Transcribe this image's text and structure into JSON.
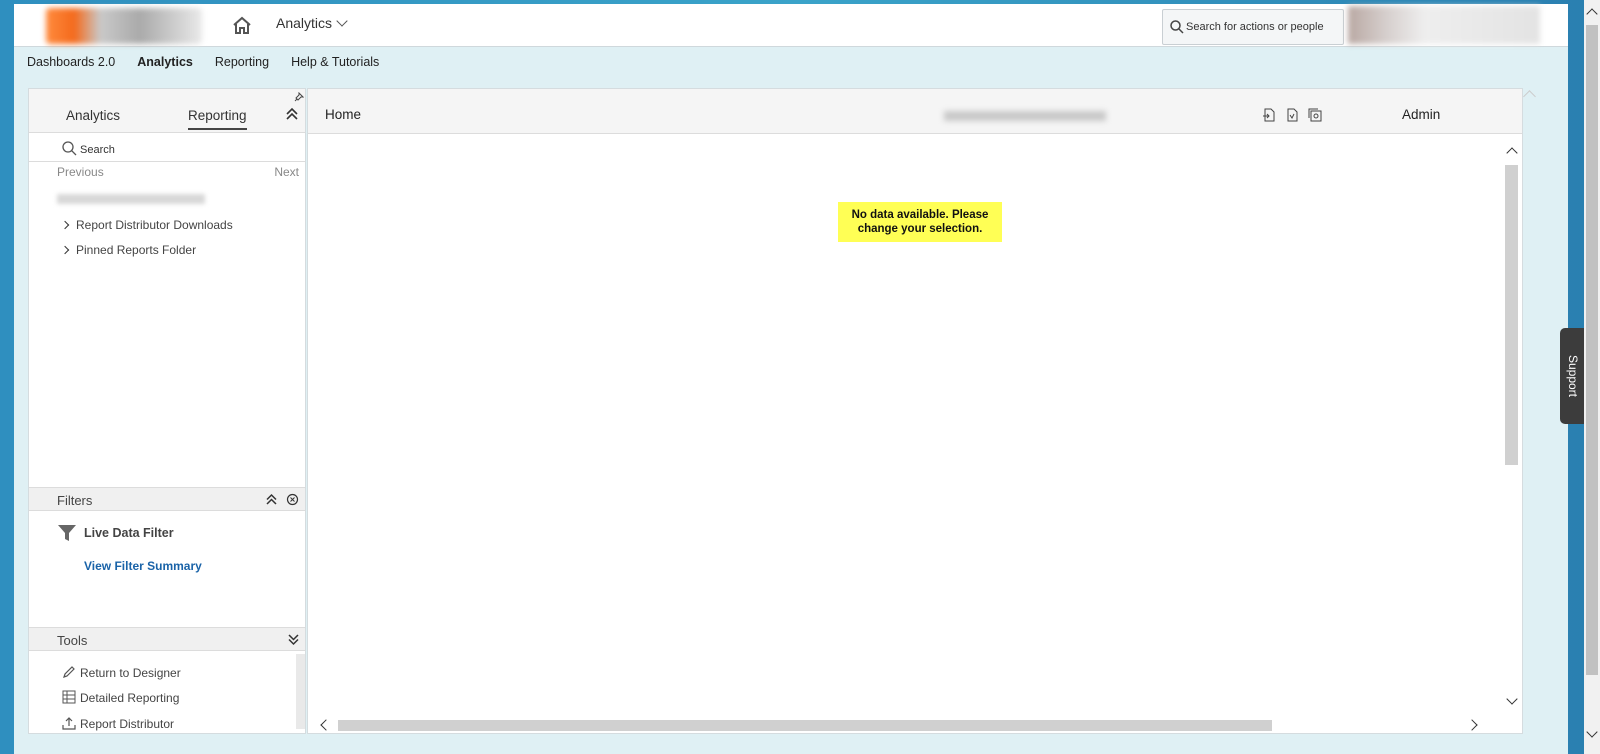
{
  "topbar": {
    "app_menu_label": "Analytics",
    "search_placeholder": "Search for actions or people"
  },
  "subnav": [
    "Dashboards 2.0",
    "Analytics",
    "Reporting",
    "Help & Tutorials"
  ],
  "left_panel": {
    "tabs": [
      "Analytics",
      "Reporting"
    ],
    "active_tab": "Reporting",
    "search_label": "Search",
    "previous_label": "Previous",
    "next_label": "Next",
    "tree_items": [
      "Report Distributor Downloads",
      "Pinned Reports Folder"
    ],
    "filters": {
      "title": "Filters",
      "live_data_filter": "Live Data Filter",
      "view_summary": "View Filter Summary"
    },
    "tools": {
      "title": "Tools",
      "items": [
        "Return to Designer",
        "Detailed Reporting",
        "Report Distributor"
      ]
    }
  },
  "main_panel": {
    "home_label": "Home",
    "admin_label": "Admin",
    "no_data_message": "No data available. Please change your selection."
  },
  "support_label": "Support"
}
